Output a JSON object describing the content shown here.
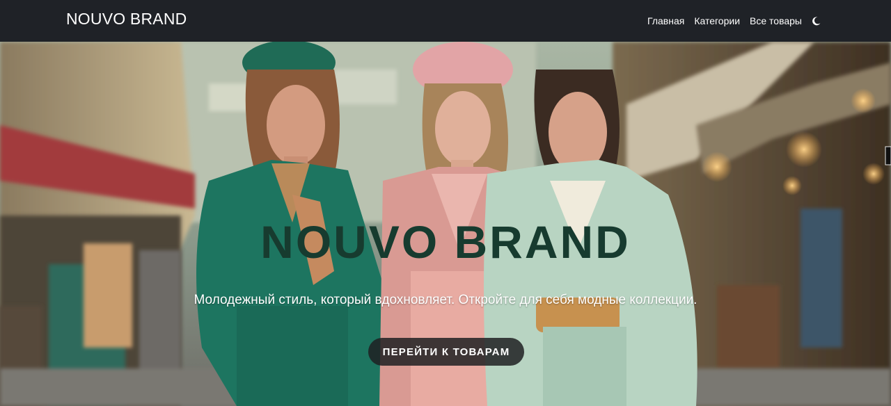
{
  "navbar": {
    "brand": "NOUVO BRAND",
    "links": [
      "Главная",
      "Категории",
      "Все товары"
    ],
    "theme_icon": "moon-icon"
  },
  "hero": {
    "title": "NOUVO BRAND",
    "subtitle": "Молодежный стиль, который вдохновляет. Откройте для себя модные коллекции.",
    "button_label": "ПЕРЕЙТИ К ТОВАРАМ",
    "title_color": "#173b2f",
    "image": "three-models-street-photo"
  },
  "colors": {
    "navbar_bg": "#1f2227",
    "button_bg": "#1e2022"
  }
}
